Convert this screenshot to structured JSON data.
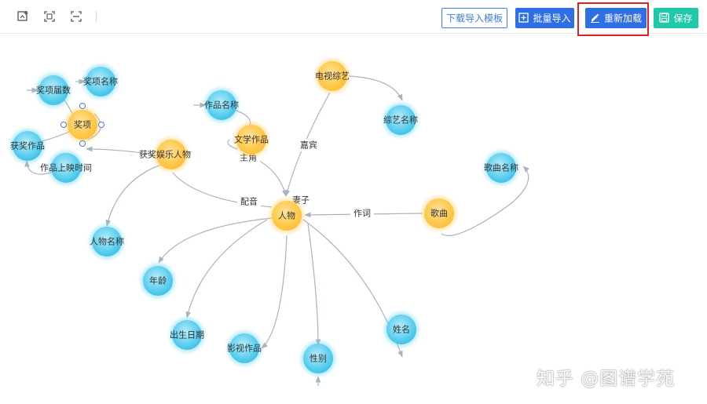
{
  "toolbar": {
    "tools": [
      {
        "name": "add-node-icon"
      },
      {
        "name": "fit-view-icon"
      },
      {
        "name": "center-view-icon"
      }
    ],
    "download_template_label": "下载导入模板",
    "batch_import_label": "批量导入",
    "reload_label": "重新加载",
    "save_label": "保存",
    "primary_color": "#2f6fe6",
    "save_color": "#1fc8a8",
    "highlight_color": "#e02020"
  },
  "graph": {
    "colors": {
      "entity": "#ffc94d",
      "attribute": "#5fd0ef",
      "edge": "#aab3bf"
    },
    "nodes": [
      {
        "id": "person",
        "label": "人物",
        "kind": "entity"
      },
      {
        "id": "award",
        "label": "奖项",
        "kind": "entity"
      },
      {
        "id": "award_person",
        "label": "获奖娱乐人物",
        "kind": "entity"
      },
      {
        "id": "work",
        "label": "文学作品",
        "kind": "entity"
      },
      {
        "id": "tv",
        "label": "电视综艺",
        "kind": "entity"
      },
      {
        "id": "song",
        "label": "歌曲",
        "kind": "entity"
      },
      {
        "id": "award_session",
        "label": "奖项届数",
        "kind": "attribute"
      },
      {
        "id": "award_name",
        "label": "奖项名称",
        "kind": "attribute"
      },
      {
        "id": "award_work",
        "label": "获奖作品",
        "kind": "attribute"
      },
      {
        "id": "release_time",
        "label": "作品上映时间",
        "kind": "attribute"
      },
      {
        "id": "work_name",
        "label": "作品名称",
        "kind": "attribute"
      },
      {
        "id": "variety_name",
        "label": "综艺名称",
        "kind": "attribute"
      },
      {
        "id": "song_name",
        "label": "歌曲名称",
        "kind": "attribute"
      },
      {
        "id": "person_name",
        "label": "人物名称",
        "kind": "attribute"
      },
      {
        "id": "age",
        "label": "年龄",
        "kind": "attribute"
      },
      {
        "id": "birth",
        "label": "出生日期",
        "kind": "attribute"
      },
      {
        "id": "films",
        "label": "影视作品",
        "kind": "attribute"
      },
      {
        "id": "gender",
        "label": "性别",
        "kind": "attribute"
      },
      {
        "id": "fullname",
        "label": "姓名",
        "kind": "attribute"
      }
    ],
    "edge_labels": [
      "嘉宾",
      "主角",
      "妻子",
      "配音",
      "作词"
    ]
  },
  "watermark": "知乎 @图谱学苑"
}
